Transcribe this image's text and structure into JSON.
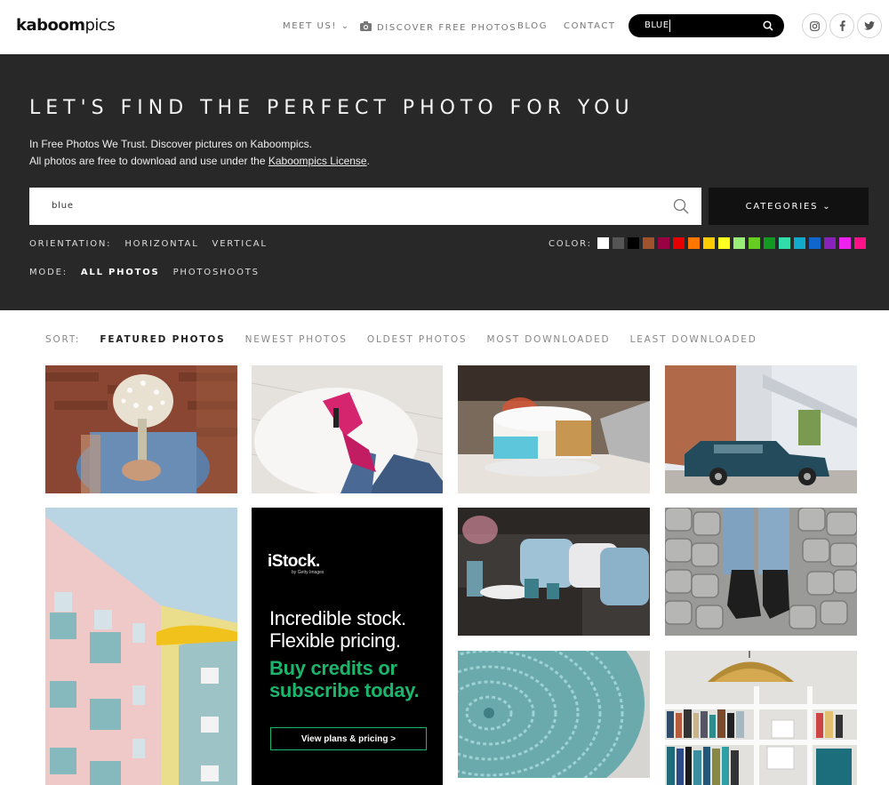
{
  "header": {
    "logo_bold": "kaboom",
    "logo_light": "pics",
    "nav": {
      "meet": "MEET US! ⌄",
      "discover": "DISCOVER FREE PHOTOS",
      "blog": "BLOG",
      "contact": "CONTACT"
    },
    "search_value": "BLUE",
    "social_icons": [
      "instagram-icon",
      "facebook-icon",
      "twitter-icon"
    ]
  },
  "hero": {
    "title": "LET'S FIND THE PERFECT PHOTO FOR YOU",
    "line1": "In Free Photos We Trust. Discover pictures on Kaboompics.",
    "line2_prefix": "All photos are free to download and use under the ",
    "line2_link": "Kaboompics License",
    "line2_suffix": ".",
    "search_value": "blue",
    "categories_label": "CATEGORIES ⌄",
    "orientation": {
      "label": "ORIENTATION:",
      "options": [
        "HORIZONTAL",
        "VERTICAL"
      ]
    },
    "mode": {
      "label": "MODE:",
      "options": [
        "ALL PHOTOS",
        "PHOTOSHOOTS"
      ],
      "active": "ALL PHOTOS"
    },
    "color_label": "COLOR:",
    "colors": [
      "#ffffff",
      "#555555",
      "#000000",
      "#a0522d",
      "#990044",
      "#e60000",
      "#ff7700",
      "#ffcc00",
      "#ffff22",
      "#99ee77",
      "#66cc22",
      "#119922",
      "#33ddaa",
      "#11aacc",
      "#1166cc",
      "#8822bb",
      "#ee22ee",
      "#ff1188"
    ]
  },
  "sort": {
    "label": "SORT:",
    "options": [
      "FEATURED PHOTOS",
      "NEWEST PHOTOS",
      "OLDEST PHOTOS",
      "MOST DOWNLOADED",
      "LEAST DOWNLOADED"
    ],
    "active": "FEATURED PHOTOS"
  },
  "ad": {
    "brand": "iStock.",
    "brand_sub": "by Getty Images",
    "headline": "Incredible stock. Flexible pricing.",
    "headline2": "Buy credits or subscribe today.",
    "cta": "View plans & pricing >"
  }
}
